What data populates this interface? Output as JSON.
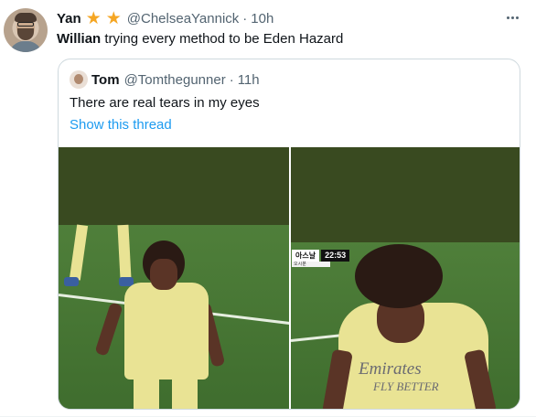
{
  "tweet": {
    "author_name": "Yan",
    "badges": [
      "star-icon",
      "star-icon"
    ],
    "handle": "@ChelseaYannick",
    "separator": "·",
    "time": "10h",
    "text_bold": "Willian",
    "text_rest": " trying every method to be Eden Hazard"
  },
  "quoted": {
    "author_name": "Tom",
    "handle": "@Tomthegunner",
    "separator": "·",
    "time": "11h",
    "text": "There are real tears in my eyes",
    "thread_link": "Show this thread"
  },
  "media": {
    "scoreboard_team": "아스날",
    "scoreboard_clock": "22:53",
    "scoreboard_sub": "오시분",
    "sponsor_line1": "Emirates",
    "sponsor_line2": "FLY BETTER"
  },
  "colors": {
    "accent": "#1d9bf0",
    "star": "#f5a623",
    "kit": "#e9e394",
    "pitch": "#4f7f3a"
  }
}
